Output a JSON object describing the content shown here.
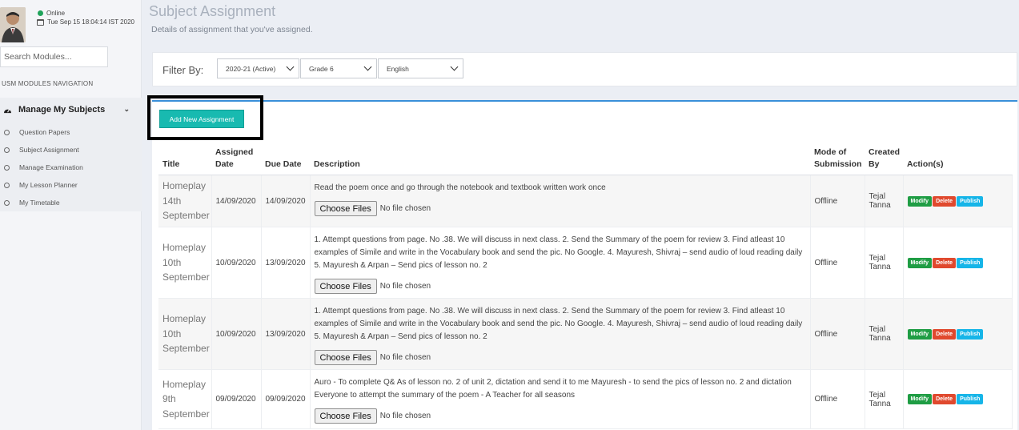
{
  "user": {
    "status": "Online",
    "datetime": "Tue Sep 15 18:04:14 IST 2020",
    "status_color": "#1fa35a"
  },
  "search": {
    "placeholder": "Search Modules..."
  },
  "sidebar": {
    "nav_heading": "USM MODULES NAVIGATION",
    "group_title": "Manage My Subjects",
    "items": [
      {
        "label": "Question Papers"
      },
      {
        "label": "Subject Assignment"
      },
      {
        "label": "Manage Examination"
      },
      {
        "label": "My Lesson Planner"
      },
      {
        "label": "My Timetable"
      }
    ]
  },
  "page": {
    "title": "Subject Assignment",
    "subtitle": "Details of assignment that you've assigned."
  },
  "filter": {
    "label": "Filter By:",
    "year": "2020-21 (Active)",
    "grade": "Grade 6",
    "subject": "English"
  },
  "add_button": "Add New Assignment",
  "table": {
    "headers": {
      "title": "Title",
      "assigned_date": "Assigned Date",
      "due_date": "Due Date",
      "description": "Description",
      "mode": "Mode of Submission",
      "created_by": "Created By",
      "actions": "Action(s)"
    },
    "rows": [
      {
        "title": "Homeplay 14th September",
        "assigned": "14/09/2020",
        "due": "14/09/2020",
        "description": "Read the poem once and go through the notebook and textbook written work once",
        "mode": "Offline",
        "created_by": "Tejal Tanna"
      },
      {
        "title": "Homeplay 10th September",
        "assigned": "10/09/2020",
        "due": "13/09/2020",
        "description": "1. Attempt questions from page. No .38. We will discuss in next class. 2. Send the Summary of the poem for review 3. Find atleast 10 examples of Simile and write in the Vocabulary book and send the pic. No Google. 4. Mayuresh, Shivraj – send audio of loud reading daily 5. Mayuresh & Arpan – Send pics of lesson no. 2",
        "mode": "Offline",
        "created_by": "Tejal Tanna"
      },
      {
        "title": "Homeplay 10th September",
        "assigned": "10/09/2020",
        "due": "13/09/2020",
        "description": "1. Attempt questions from page. No .38. We will discuss in next class. 2. Send the Summary of the poem for review 3. Find atleast 10 examples of Simile and write in the Vocabulary book and send the pic. No Google. 4. Mayuresh, Shivraj – send audio of loud reading daily 5. Mayuresh & Arpan – Send pics of lesson no. 2",
        "mode": "Offline",
        "created_by": "Tejal Tanna"
      },
      {
        "title": "Homeplay 9th September",
        "assigned": "09/09/2020",
        "due": "09/09/2020",
        "description": "Auro - To complete Q& As of lesson no. 2 of unit 2, dictation and send it to me Mayuresh - to send the pics of lesson no. 2 and dictation Everyone to attempt the summary of the poem - A Teacher for all seasons",
        "mode": "Offline",
        "created_by": "Tejal Tanna"
      }
    ],
    "file_button": "Choose Files",
    "file_status": "No file chosen",
    "action_labels": {
      "modify": "Modify",
      "delete": "Delete",
      "publish": "Publish"
    }
  },
  "colors": {
    "accent": "#3a8fd9",
    "add_button": "#18bab0",
    "modify": "#1f9d44",
    "delete": "#e0492e",
    "publish": "#16b5e8"
  }
}
